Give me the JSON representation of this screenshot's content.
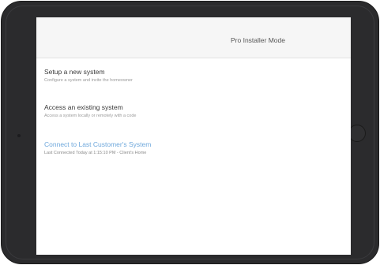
{
  "header": {
    "title": "Pro Installer Mode"
  },
  "menu": {
    "items": [
      {
        "title": "Setup a new system",
        "subtitle": "Configure a system and invite the homeowner"
      },
      {
        "title": "Access an existing system",
        "subtitle": "Access a system locally or remotely with a code"
      },
      {
        "title": "Connect to Last Customer's System",
        "subtitle": "Last Connected Today at 1:15:10 PM - Client's Home"
      }
    ]
  },
  "colors": {
    "bezel": "#2b2b2d",
    "link": "#6fa8dc",
    "nav_background": "#f6f6f6"
  }
}
